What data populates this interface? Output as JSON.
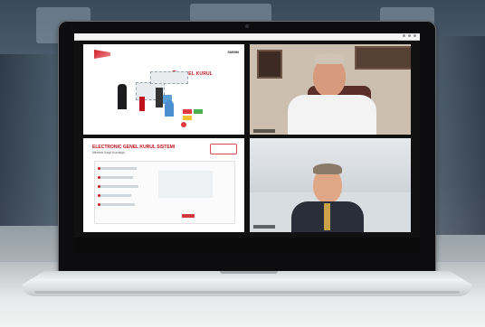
{
  "scene": {
    "description_tag": "",
    "colors": {
      "brand_red": "#c0121b",
      "laptop_bezel": "#0d0d0f",
      "shirt_white": "#f3f3f3",
      "suit_dark": "#2a2e38"
    }
  },
  "slide_top": {
    "title": "e-GENEL KURUL",
    "corner_label": "SMMM"
  },
  "slide_bottom": {
    "title": "ELECTRONIC GENEL KURUL SISTEMI",
    "subtitle": "Merkezi Kayıt Kuruluşu"
  }
}
